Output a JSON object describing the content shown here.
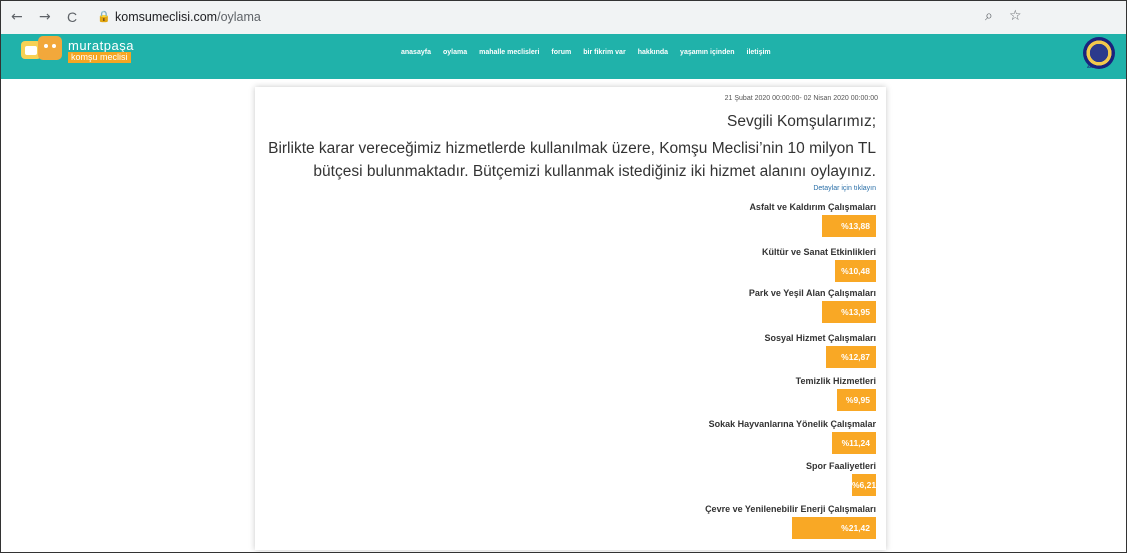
{
  "browser": {
    "back_icon": "←",
    "forward_icon": "→",
    "reload_icon": "C",
    "lock_icon": "🔒",
    "url_host": "komsumeclisi.com",
    "url_path": "/oylama",
    "zoom_icon": "🔍",
    "star_icon": "☆"
  },
  "header": {
    "logo_line1": "muratpaşa",
    "logo_line2": "komşu meclisi",
    "nav": [
      "anasayfa",
      "oylama",
      "mahalle meclisleri",
      "forum",
      "bir fikrim var",
      "hakkında",
      "yaşamın içinden",
      "iletişim"
    ],
    "emblem_text": "ANTALYA"
  },
  "content": {
    "date_range": "21 Şubat 2020 00:00:00- 02 Nisan 2020 00:00:00",
    "greeting": "Sevgili Komşularımız;",
    "description": "Birlikte karar vereceğimiz hizmetlerde kullanılmak üzere, Komşu Meclisi’nin 10 milyon TL bütçesi bulunmaktadır. Bütçemizi kullanmak istediğiniz iki hizmet alanını oylayınız.",
    "details_link": "Detaylar için tıklayın",
    "accent_color": "#f9a825",
    "items": [
      {
        "label": "Asfalt ve Kaldırım Çalışmaları",
        "value": "%13,88",
        "percent": 13.88
      },
      {
        "label": "Kültür ve Sanat Etkinlikleri",
        "value": "%10,48",
        "percent": 10.48
      },
      {
        "label": "Park ve Yeşil Alan Çalışmaları",
        "value": "%13,95",
        "percent": 13.95
      },
      {
        "label": "Sosyal Hizmet Çalışmaları",
        "value": "%12,87",
        "percent": 12.87
      },
      {
        "label": "Temizlik Hizmetleri",
        "value": "%9,95",
        "percent": 9.95
      },
      {
        "label": "Sokak Hayvanlarına Yönelik Çalışmalar",
        "value": "%11,24",
        "percent": 11.24
      },
      {
        "label": "Spor Faaliyetleri",
        "value": "%6,21",
        "percent": 6.21
      },
      {
        "label": "Çevre ve Yenilenebilir Enerji Çalışmaları",
        "value": "%21,42",
        "percent": 21.42
      }
    ]
  }
}
